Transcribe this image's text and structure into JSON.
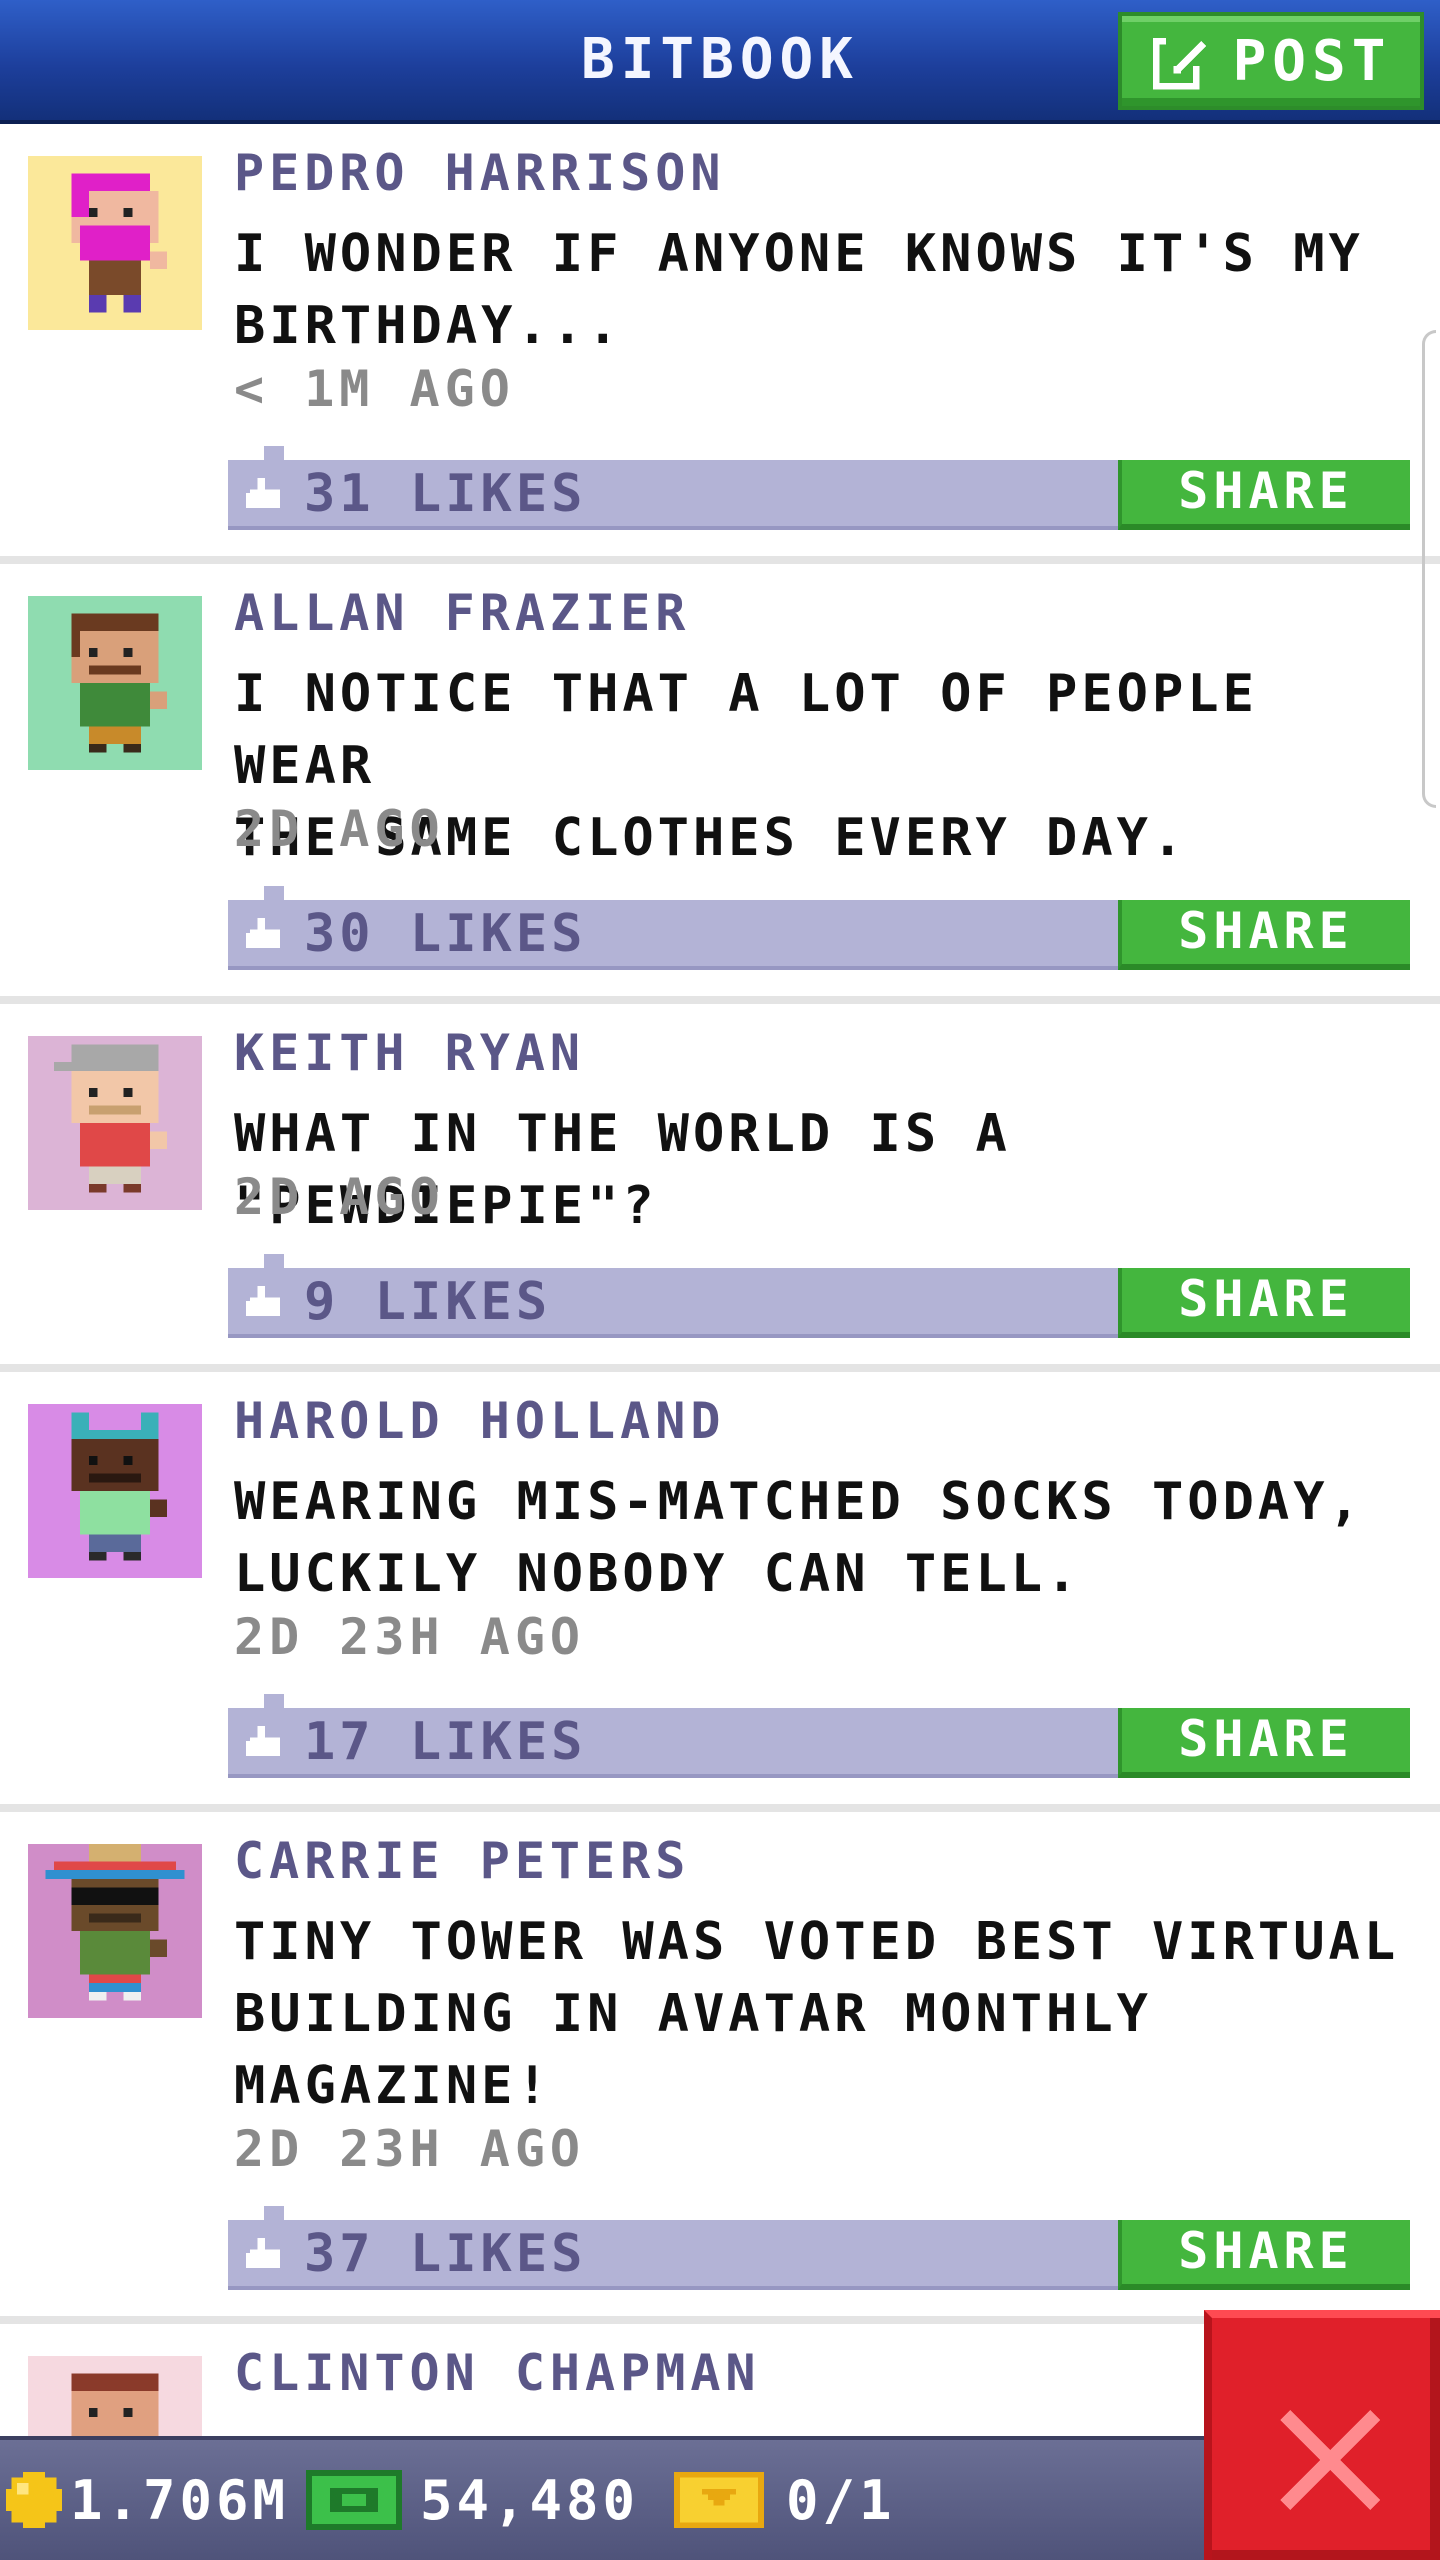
{
  "header": {
    "title": "BITBOOK",
    "post_label": "POST"
  },
  "posts": [
    {
      "author": "PEDRO HARRISON",
      "lines": [
        "I WONDER IF ANYONE KNOWS IT'S MY",
        "BIRTHDAY..."
      ],
      "time": "< 1M AGO",
      "likes": "31 LIKES",
      "share": "SHARE",
      "avatar_bg": "#fbe89a"
    },
    {
      "author": "ALLAN FRAZIER",
      "lines": [
        "I NOTICE THAT A LOT OF PEOPLE WEAR",
        "THE SAME CLOTHES EVERY DAY."
      ],
      "time": "2D AGO",
      "likes": "30 LIKES",
      "share": "SHARE",
      "avatar_bg": "#8fdcb0"
    },
    {
      "author": "KEITH RYAN",
      "lines": [
        "WHAT IN THE WORLD IS A \"PEWDIEPIE\"?"
      ],
      "time": "2D AGO",
      "likes": "9 LIKES",
      "share": "SHARE",
      "avatar_bg": "#dcb4d6"
    },
    {
      "author": "HAROLD HOLLAND",
      "lines": [
        "WEARING MIS-MATCHED SOCKS TODAY,",
        "LUCKILY NOBODY CAN TELL."
      ],
      "time": "2D 23H AGO",
      "likes": "17 LIKES",
      "share": "SHARE",
      "avatar_bg": "#d88be6"
    },
    {
      "author": "CARRIE PETERS",
      "lines": [
        "TINY TOWER WAS VOTED BEST VIRTUAL",
        "BUILDING IN AVATAR MONTHLY",
        "MAGAZINE!"
      ],
      "time": "2D 23H AGO",
      "likes": "37 LIKES",
      "share": "SHARE",
      "avatar_bg": "#d08dc8"
    },
    {
      "author": "CLINTON CHAPMAN",
      "lines": [],
      "time": "",
      "likes": "",
      "share": "",
      "avatar_bg": "#f6d9e0"
    }
  ],
  "status_bar": {
    "coins": "1.706M",
    "bux": "54,480",
    "tickets": "0/1"
  },
  "colors": {
    "header_blue": "#1d3f9c",
    "button_green": "#44b63e",
    "likes_bar": "#b3b3d6",
    "close_red": "#e0202a"
  }
}
